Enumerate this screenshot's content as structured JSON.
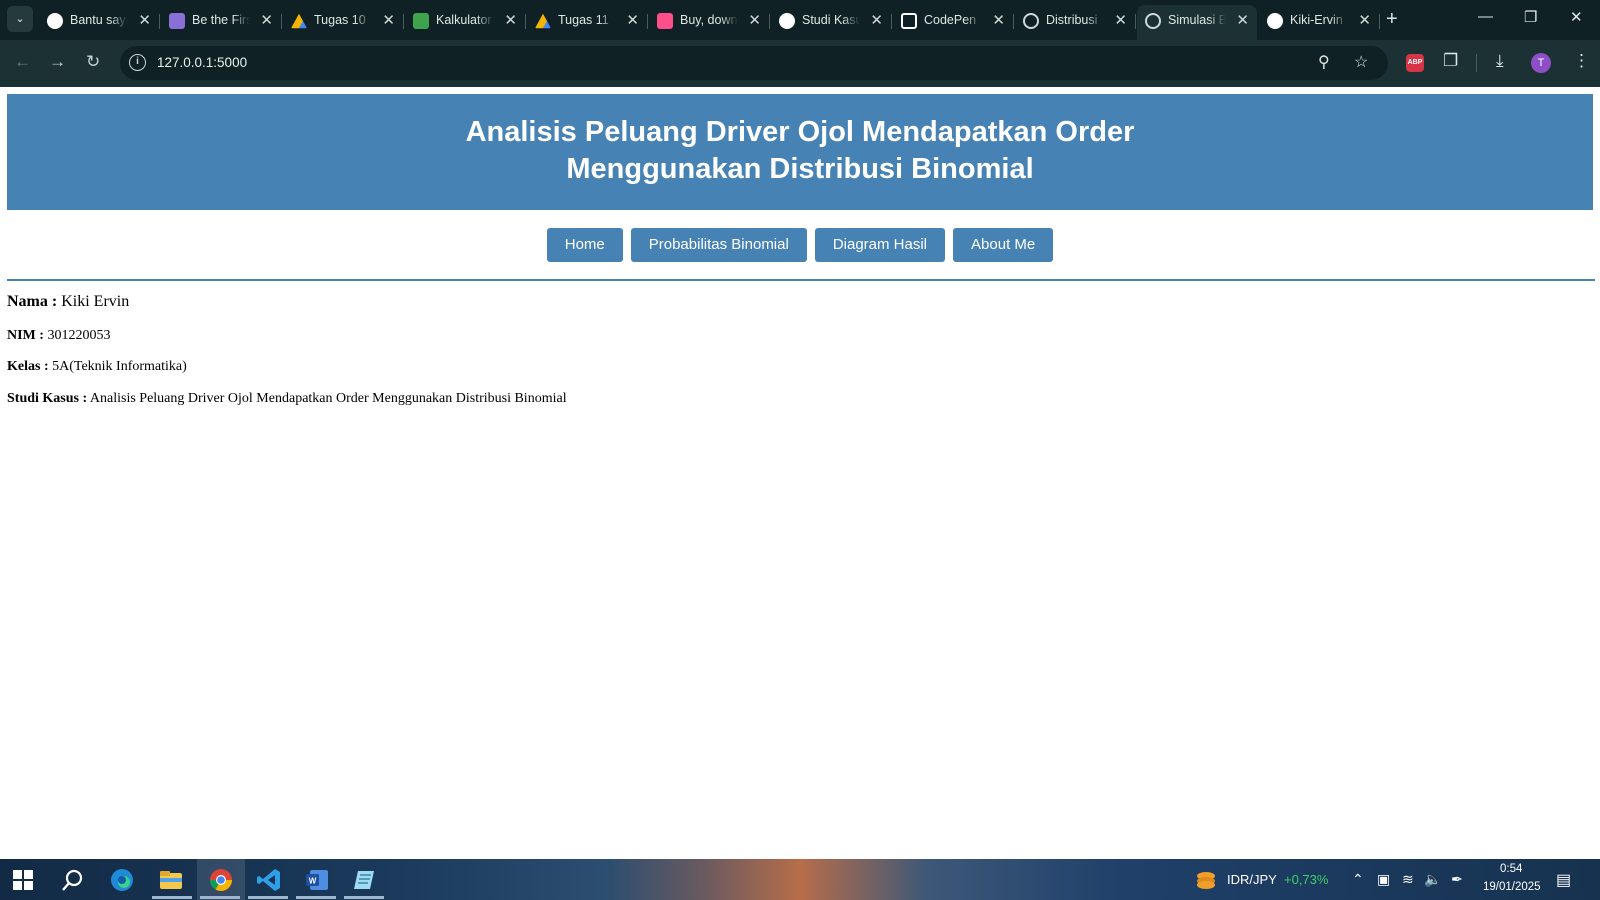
{
  "browser": {
    "tabs": [
      {
        "title": "Bantu saya",
        "icon": "chatgpt-icon",
        "color": "#ffffff",
        "active": false
      },
      {
        "title": "Be the First",
        "icon": "h-logo-icon",
        "color": "#8a6fd6",
        "active": false
      },
      {
        "title": "Tugas 10",
        "icon": "google-drive-icon",
        "color": "#f4b400",
        "active": false
      },
      {
        "title": "Kalkulator",
        "icon": "calculator-app-icon",
        "color": "#3fa34d",
        "active": false
      },
      {
        "title": "Tugas 11",
        "icon": "google-drive-icon",
        "color": "#f4b400",
        "active": false
      },
      {
        "title": "Buy, download",
        "icon": "envato-icon",
        "color": "#ff4f8b",
        "active": false
      },
      {
        "title": "Studi Kasus",
        "icon": "chatgpt-icon",
        "color": "#ffffff",
        "active": false
      },
      {
        "title": "CodePen",
        "icon": "codepen-icon",
        "color": "#ffffff",
        "active": false
      },
      {
        "title": "Distribusi",
        "icon": "globe-icon",
        "color": "#cfd8d8",
        "active": false
      },
      {
        "title": "Simulasi Binomial",
        "icon": "globe-icon",
        "color": "#cfd8d8",
        "active": true
      },
      {
        "title": "Kiki-Ervin",
        "icon": "github-icon",
        "color": "#ffffff",
        "active": false
      }
    ],
    "url": "127.0.0.1:5000",
    "profile_initial": "T",
    "extension_label": "ABP"
  },
  "page": {
    "title_line1": "Analisis Peluang Driver Ojol Mendapatkan Order",
    "title_line2": "Menggunakan Distribusi Binomial",
    "nav": [
      {
        "label": "Home"
      },
      {
        "label": "Probabilitas Binomial"
      },
      {
        "label": "Diagram Hasil"
      },
      {
        "label": "About Me"
      }
    ],
    "profile": {
      "nama_label": "Nama :",
      "nama_value": "Kiki Ervin",
      "nim_label": "NIM :",
      "nim_value": "301220053",
      "kelas_label": "Kelas :",
      "kelas_value": "5A(Teknik Informatika)",
      "studi_label": "Studi Kasus :",
      "studi_value": "Analisis Peluang Driver Ojol Mendapatkan Order Menggunakan Distribusi Binomial"
    },
    "accent_color": "#4682b4"
  },
  "taskbar": {
    "ticker_label": "IDR/JPY",
    "ticker_change": "+0,73%",
    "ticker_color": "#3ccf6a",
    "time": "0:54",
    "date": "19/01/2025"
  }
}
